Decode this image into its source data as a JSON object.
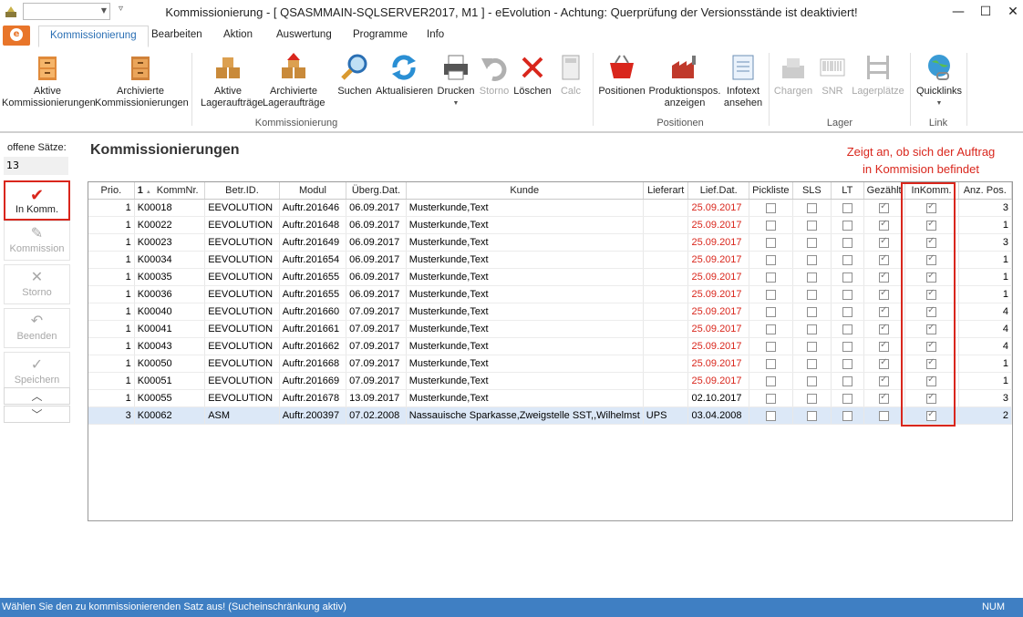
{
  "window": {
    "title": "Kommissionierung - [ QSASMMAIN-SQLSERVER2017, M1 ]  -  eEvolution - Achtung: Querprüfung der Versionsstände ist deaktiviert!"
  },
  "tabs": [
    "Kommissionierung",
    "Bearbeiten",
    "Aktion",
    "Auswertung",
    "Programme",
    "Info"
  ],
  "ribbon": {
    "aktive_komm": "Aktive\nKommissionierungen",
    "archivierte_komm": "Archivierte\nKommissionierungen",
    "aktive_lager": "Aktive\nLageraufträge",
    "archivierte_lager": "Archivierte\nLageraufträge",
    "suchen": "Suchen",
    "aktualisieren": "Aktualisieren",
    "drucken": "Drucken",
    "storno": "Storno",
    "loeschen": "Löschen",
    "calc": "Calc",
    "positionen": "Positionen",
    "produktionspos": "Produktionspos.\nanzeigen",
    "infotext": "Infotext\nansehen",
    "chargen": "Chargen",
    "snr": "SNR",
    "lagerplaetze": "Lagerplätze",
    "quicklinks": "Quicklinks",
    "group_komm": "Kommissionierung",
    "group_pos": "Positionen",
    "group_lager": "Lager",
    "group_link": "Link"
  },
  "left": {
    "offene_label": "offene Sätze:",
    "offene_value": "13",
    "in_komm": "In Komm.",
    "kommission": "Kommission",
    "storno": "Storno",
    "beenden": "Beenden",
    "speichern": "Speichern"
  },
  "main": {
    "heading": "Kommissionierungen",
    "annotation_line1": "Zeigt an, ob sich der Auftrag",
    "annotation_line2": "in Kommision befindet"
  },
  "grid": {
    "sort_marker": "1",
    "columns": [
      "Prio.",
      "KommNr.",
      "Betr.ID.",
      "Modul",
      "Überg.Dat.",
      "Kunde",
      "Lieferart",
      "Lief.Dat.",
      "Pickliste",
      "SLS",
      "LT",
      "Gezählt",
      "InKomm.",
      "Anz. Pos."
    ],
    "rows": [
      {
        "prio": "1",
        "komm": "K00018",
        "betr": "EEVOLUTION",
        "modul": "Auftr.201646",
        "ueberg": "06.09.2017",
        "kunde": "Musterkunde,Text",
        "lieferart": "",
        "lief": "25.09.2017",
        "pick": false,
        "sls": false,
        "lt": false,
        "gez": true,
        "ink": true,
        "anz": "3",
        "red": true,
        "sel": false
      },
      {
        "prio": "1",
        "komm": "K00022",
        "betr": "EEVOLUTION",
        "modul": "Auftr.201648",
        "ueberg": "06.09.2017",
        "kunde": "Musterkunde,Text",
        "lieferart": "",
        "lief": "25.09.2017",
        "pick": false,
        "sls": false,
        "lt": false,
        "gez": true,
        "ink": true,
        "anz": "1",
        "red": true,
        "sel": false
      },
      {
        "prio": "1",
        "komm": "K00023",
        "betr": "EEVOLUTION",
        "modul": "Auftr.201649",
        "ueberg": "06.09.2017",
        "kunde": "Musterkunde,Text",
        "lieferart": "",
        "lief": "25.09.2017",
        "pick": false,
        "sls": false,
        "lt": false,
        "gez": true,
        "ink": true,
        "anz": "3",
        "red": true,
        "sel": false
      },
      {
        "prio": "1",
        "komm": "K00034",
        "betr": "EEVOLUTION",
        "modul": "Auftr.201654",
        "ueberg": "06.09.2017",
        "kunde": "Musterkunde,Text",
        "lieferart": "",
        "lief": "25.09.2017",
        "pick": false,
        "sls": false,
        "lt": false,
        "gez": true,
        "ink": true,
        "anz": "1",
        "red": true,
        "sel": false
      },
      {
        "prio": "1",
        "komm": "K00035",
        "betr": "EEVOLUTION",
        "modul": "Auftr.201655",
        "ueberg": "06.09.2017",
        "kunde": "Musterkunde,Text",
        "lieferart": "",
        "lief": "25.09.2017",
        "pick": false,
        "sls": false,
        "lt": false,
        "gez": true,
        "ink": true,
        "anz": "1",
        "red": true,
        "sel": false
      },
      {
        "prio": "1",
        "komm": "K00036",
        "betr": "EEVOLUTION",
        "modul": "Auftr.201655",
        "ueberg": "06.09.2017",
        "kunde": "Musterkunde,Text",
        "lieferart": "",
        "lief": "25.09.2017",
        "pick": false,
        "sls": false,
        "lt": false,
        "gez": true,
        "ink": true,
        "anz": "1",
        "red": true,
        "sel": false
      },
      {
        "prio": "1",
        "komm": "K00040",
        "betr": "EEVOLUTION",
        "modul": "Auftr.201660",
        "ueberg": "07.09.2017",
        "kunde": "Musterkunde,Text",
        "lieferart": "",
        "lief": "25.09.2017",
        "pick": false,
        "sls": false,
        "lt": false,
        "gez": true,
        "ink": true,
        "anz": "4",
        "red": true,
        "sel": false
      },
      {
        "prio": "1",
        "komm": "K00041",
        "betr": "EEVOLUTION",
        "modul": "Auftr.201661",
        "ueberg": "07.09.2017",
        "kunde": "Musterkunde,Text",
        "lieferart": "",
        "lief": "25.09.2017",
        "pick": false,
        "sls": false,
        "lt": false,
        "gez": true,
        "ink": true,
        "anz": "4",
        "red": true,
        "sel": false
      },
      {
        "prio": "1",
        "komm": "K00043",
        "betr": "EEVOLUTION",
        "modul": "Auftr.201662",
        "ueberg": "07.09.2017",
        "kunde": "Musterkunde,Text",
        "lieferart": "",
        "lief": "25.09.2017",
        "pick": false,
        "sls": false,
        "lt": false,
        "gez": true,
        "ink": true,
        "anz": "4",
        "red": true,
        "sel": false
      },
      {
        "prio": "1",
        "komm": "K00050",
        "betr": "EEVOLUTION",
        "modul": "Auftr.201668",
        "ueberg": "07.09.2017",
        "kunde": "Musterkunde,Text",
        "lieferart": "",
        "lief": "25.09.2017",
        "pick": false,
        "sls": false,
        "lt": false,
        "gez": true,
        "ink": true,
        "anz": "1",
        "red": true,
        "sel": false
      },
      {
        "prio": "1",
        "komm": "K00051",
        "betr": "EEVOLUTION",
        "modul": "Auftr.201669",
        "ueberg": "07.09.2017",
        "kunde": "Musterkunde,Text",
        "lieferart": "",
        "lief": "25.09.2017",
        "pick": false,
        "sls": false,
        "lt": false,
        "gez": true,
        "ink": true,
        "anz": "1",
        "red": true,
        "sel": false
      },
      {
        "prio": "1",
        "komm": "K00055",
        "betr": "EEVOLUTION",
        "modul": "Auftr.201678",
        "ueberg": "13.09.2017",
        "kunde": "Musterkunde,Text",
        "lieferart": "",
        "lief": "02.10.2017",
        "pick": false,
        "sls": false,
        "lt": false,
        "gez": true,
        "ink": true,
        "anz": "3",
        "red": false,
        "sel": false
      },
      {
        "prio": "3",
        "komm": "K00062",
        "betr": "ASM",
        "modul": "Auftr.200397",
        "ueberg": "07.02.2008",
        "kunde": "Nassauische Sparkasse,Zweigstelle SST,,Wilhelmst",
        "lieferart": "UPS",
        "lief": "03.04.2008",
        "pick": false,
        "sls": false,
        "lt": false,
        "gez": false,
        "ink": true,
        "anz": "2",
        "red": false,
        "sel": true
      }
    ]
  },
  "status": {
    "message": "Wählen Sie den zu kommissionierenden Satz aus! (Sucheinschränkung aktiv)",
    "num": "NUM"
  },
  "colors": {
    "accent_red": "#d9261c",
    "status_blue": "#3f7fc3",
    "tab_blue": "#2a6fb4",
    "file_orange": "#e8752a"
  }
}
